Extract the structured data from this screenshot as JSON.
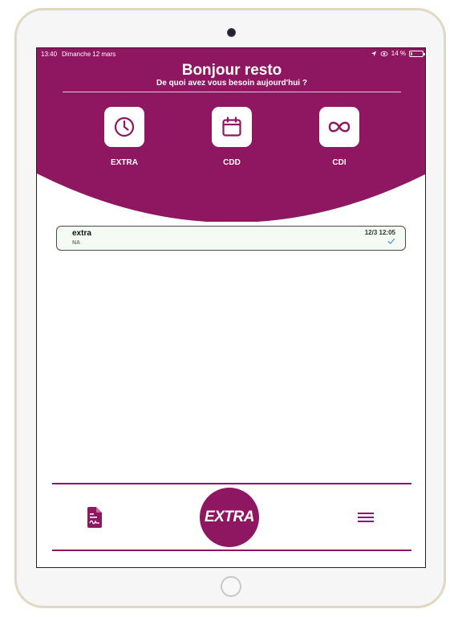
{
  "status_bar": {
    "time": "13:40",
    "date": "Dimanche 12 mars",
    "battery": "14 %",
    "battery_level": 0.14
  },
  "header": {
    "title": "Bonjour resto",
    "subtitle": "De quoi avez vous besoin aujourd'hui ?"
  },
  "categories": [
    {
      "label": "EXTRA",
      "icon": "clock-icon"
    },
    {
      "label": "CDD",
      "icon": "calendar-icon"
    },
    {
      "label": "CDI",
      "icon": "infinity-icon"
    }
  ],
  "list": [
    {
      "title": "extra",
      "subtitle": "NA",
      "date": "12/3 12:05",
      "status_icon": "checkmark-icon"
    }
  ],
  "bottom_bar": {
    "center_label": "EXTRA",
    "left_icon": "document-signature-icon",
    "right_icon": "hamburger-menu-icon"
  },
  "colors": {
    "primary": "#8F1660",
    "card_bg": "#F4FBF5",
    "check": "#4A90E2"
  }
}
